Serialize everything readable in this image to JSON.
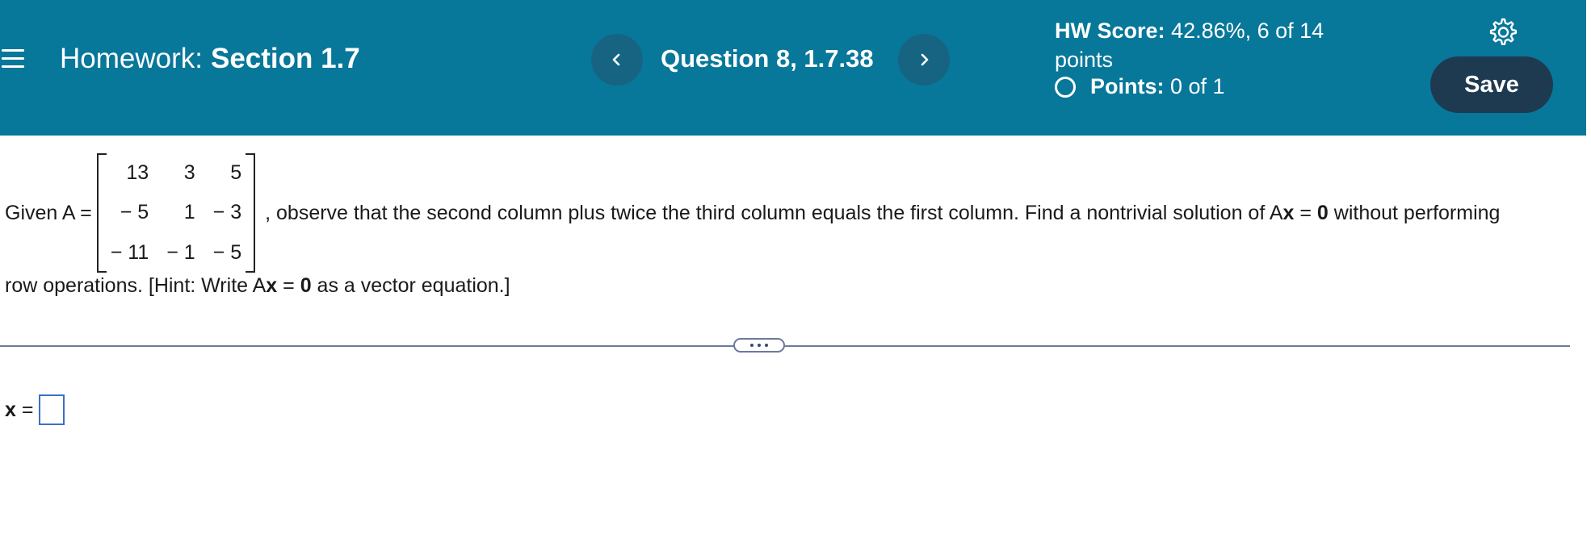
{
  "header": {
    "homework_label": "Homework:",
    "section": "Section 1.7",
    "question": "Question 8, 1.7.38",
    "prev_symbol": "‹",
    "next_symbol": "›",
    "hw_score_label": "HW Score:",
    "hw_score_value": "42.86%, 6 of 14",
    "hw_score_unit": "points",
    "points_label": "Points:",
    "points_value": "0 of 1",
    "save_label": "Save"
  },
  "question": {
    "prefix": "Given A =",
    "matrix": [
      [
        "13",
        "3",
        "5"
      ],
      [
        "− 5",
        "1",
        "− 3"
      ],
      [
        "− 11",
        "− 1",
        "− 5"
      ]
    ],
    "line1_a": ", observe that the second column plus twice the third column equals the first column. Find a nontrivial solution of A",
    "bold_x": "x",
    "equals": " = ",
    "bold_zero": "0",
    "line1_b": " without performing",
    "line2_a": "row operations. [Hint: Write A",
    "line2_b": " as a vector equation.]"
  },
  "answer": {
    "label_bold": "x",
    "label_eq": " ="
  },
  "colors": {
    "header_bg": "#07779a",
    "nav_button": "#176482",
    "save_button": "#1e3a50",
    "input_border": "#3b6fc8"
  },
  "icons": [
    "menu-icon",
    "chevron-left-icon",
    "chevron-right-icon",
    "gear-icon",
    "status-circle-icon",
    "ellipsis-icon"
  ]
}
